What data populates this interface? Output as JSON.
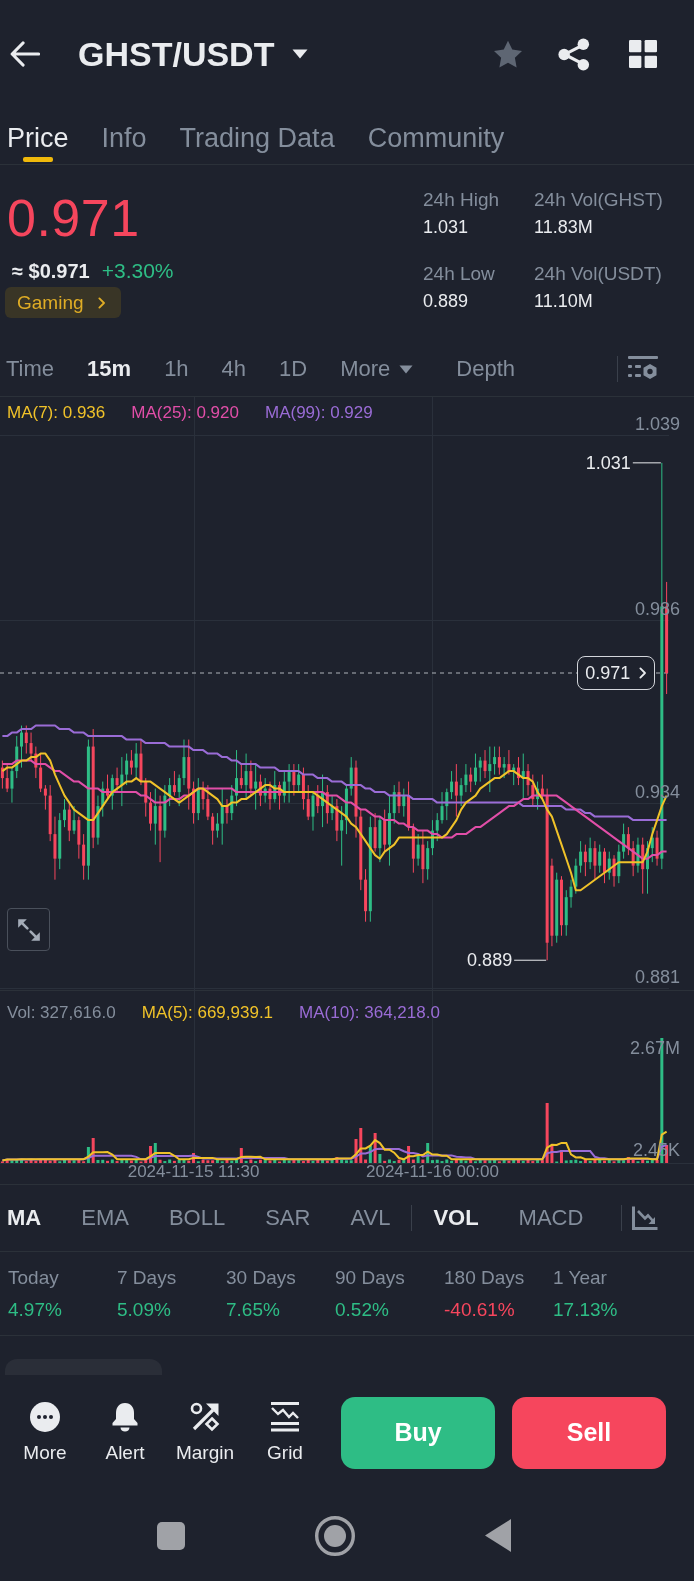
{
  "header": {
    "title": "GHST/USDT",
    "favorited": false
  },
  "tabs": [
    {
      "label": "Price",
      "selected": true
    },
    {
      "label": "Info",
      "selected": false
    },
    {
      "label": "Trading Data",
      "selected": false
    },
    {
      "label": "Community",
      "selected": false
    }
  ],
  "ticker": {
    "price": "0.971",
    "price_up": false,
    "usd_price": "≈ $0.971",
    "change": "+3.30%",
    "change_up": true,
    "tag": "Gaming"
  },
  "stats": [
    {
      "label": "24h High",
      "value": "1.031"
    },
    {
      "label": "24h Vol(GHST)",
      "value": "11.83M"
    },
    {
      "label": "24h Low",
      "value": "0.889"
    },
    {
      "label": "24h Vol(USDT)",
      "value": "11.10M"
    }
  ],
  "intervals": [
    {
      "label": "Time",
      "kind": "option",
      "selected": false
    },
    {
      "label": "15m",
      "kind": "option",
      "selected": true
    },
    {
      "label": "1h",
      "kind": "option",
      "selected": false
    },
    {
      "label": "4h",
      "kind": "option",
      "selected": false
    },
    {
      "label": "1D",
      "kind": "option",
      "selected": false
    },
    {
      "label": "More",
      "kind": "dropdown",
      "selected": false
    },
    {
      "label": "Depth",
      "kind": "view",
      "selected": false
    }
  ],
  "price_chart": {
    "chart_data": {
      "type": "candlestick",
      "grid": true,
      "ylim": [
        0.8805,
        1.0498
      ],
      "yticks": [
        {
          "value": 1.039,
          "label": "1.039"
        },
        {
          "value": 0.986,
          "label": "0.986"
        },
        {
          "value": 0.934,
          "label": "0.934"
        },
        {
          "value": 0.881,
          "label": "0.881"
        }
      ],
      "categories": [
        null,
        null,
        null,
        null,
        null,
        null,
        null,
        null,
        null,
        null,
        null,
        null,
        null,
        null,
        null,
        null,
        null,
        null,
        null,
        null,
        null,
        null,
        null,
        null,
        null,
        null,
        null,
        null,
        null,
        null,
        null,
        null,
        null,
        null,
        null,
        null,
        null,
        null,
        null,
        null,
        null,
        null,
        null,
        null,
        null,
        null,
        null,
        null,
        null,
        null,
        null,
        null,
        null,
        null,
        null,
        null,
        null,
        null,
        null,
        null,
        null,
        null,
        null,
        null,
        null,
        null,
        null,
        null,
        null,
        null,
        null,
        null,
        null,
        null,
        null,
        null,
        null,
        null,
        null,
        null,
        null,
        null,
        null,
        null,
        null,
        null,
        null,
        null,
        null,
        null,
        null,
        null,
        null,
        null,
        null,
        null,
        null,
        null,
        null,
        null,
        null,
        null,
        null,
        null,
        null,
        null,
        null,
        null,
        null,
        null,
        null,
        null,
        null,
        null,
        null,
        null,
        null,
        null,
        null,
        null,
        null,
        null,
        null,
        null,
        null,
        null,
        null,
        null,
        null,
        null,
        null,
        null,
        null,
        null,
        null,
        null,
        null,
        null,
        null,
        null
      ],
      "ohlc": [
        [
          0.944,
          0.946,
          0.938,
          0.941
        ],
        [
          0.941,
          0.945,
          0.937,
          0.938
        ],
        [
          0.938,
          0.944,
          0.934,
          0.943
        ],
        [
          0.943,
          0.953,
          0.941,
          0.95
        ],
        [
          0.95,
          0.956,
          0.944,
          0.954
        ],
        [
          0.954,
          0.956,
          0.948,
          0.951
        ],
        [
          0.951,
          0.954,
          0.946,
          0.948
        ],
        [
          0.948,
          0.95,
          0.941,
          0.944
        ],
        [
          0.944,
          0.948,
          0.937,
          0.938
        ],
        [
          0.938,
          0.939,
          0.932,
          0.936
        ],
        [
          0.936,
          0.939,
          0.923,
          0.925
        ],
        [
          0.925,
          0.93,
          0.912,
          0.918
        ],
        [
          0.918,
          0.931,
          0.915,
          0.929
        ],
        [
          0.929,
          0.935,
          0.927,
          0.932
        ],
        [
          0.932,
          0.934,
          0.923,
          0.926
        ],
        [
          0.926,
          0.933,
          0.925,
          0.929
        ],
        [
          0.929,
          0.93,
          0.918,
          0.922
        ],
        [
          0.922,
          0.925,
          0.912,
          0.916
        ],
        [
          0.916,
          0.952,
          0.912,
          0.95
        ],
        [
          0.95,
          0.955,
          0.921,
          0.924
        ],
        [
          0.924,
          0.936,
          0.922,
          0.933
        ],
        [
          0.933,
          0.94,
          0.93,
          0.938
        ],
        [
          0.938,
          0.942,
          0.935,
          0.936
        ],
        [
          0.936,
          0.942,
          0.932,
          0.941
        ],
        [
          0.941,
          0.944,
          0.937,
          0.939
        ],
        [
          0.939,
          0.947,
          0.933,
          0.942
        ],
        [
          0.942,
          0.948,
          0.939,
          0.946
        ],
        [
          0.946,
          0.949,
          0.942,
          0.944
        ],
        [
          0.944,
          0.951,
          0.941,
          0.948
        ],
        [
          0.948,
          0.952,
          0.939,
          0.94
        ],
        [
          0.94,
          0.941,
          0.93,
          0.934
        ],
        [
          0.934,
          0.937,
          0.926,
          0.928
        ],
        [
          0.928,
          0.938,
          0.922,
          0.933
        ],
        [
          0.933,
          0.936,
          0.917,
          0.926
        ],
        [
          0.926,
          0.939,
          0.924,
          0.936
        ],
        [
          0.936,
          0.941,
          0.933,
          0.939
        ],
        [
          0.939,
          0.943,
          0.936,
          0.937
        ],
        [
          0.937,
          0.942,
          0.933,
          0.941
        ],
        [
          0.941,
          0.952,
          0.939,
          0.947
        ],
        [
          0.947,
          0.952,
          0.932,
          0.938
        ],
        [
          0.938,
          0.94,
          0.928,
          0.931
        ],
        [
          0.931,
          0.941,
          0.929,
          0.938
        ],
        [
          0.938,
          0.94,
          0.932,
          0.935
        ],
        [
          0.935,
          0.939,
          0.929,
          0.93
        ],
        [
          0.93,
          0.931,
          0.922,
          0.926
        ],
        [
          0.926,
          0.931,
          0.924,
          0.928
        ],
        [
          0.928,
          0.938,
          0.922,
          0.933
        ],
        [
          0.933,
          0.935,
          0.928,
          0.931
        ],
        [
          0.931,
          0.939,
          0.929,
          0.936
        ],
        [
          0.936,
          0.949,
          0.933,
          0.941
        ],
        [
          0.941,
          0.945,
          0.938,
          0.939
        ],
        [
          0.939,
          0.948,
          0.935,
          0.943
        ],
        [
          0.943,
          0.946,
          0.936,
          0.938
        ],
        [
          0.938,
          0.945,
          0.932,
          0.94
        ],
        [
          0.94,
          0.942,
          0.933,
          0.936
        ],
        [
          0.936,
          0.941,
          0.934,
          0.938
        ],
        [
          0.938,
          0.94,
          0.932,
          0.935
        ],
        [
          0.935,
          0.943,
          0.934,
          0.939
        ],
        [
          0.939,
          0.94,
          0.932,
          0.936
        ],
        [
          0.936,
          0.943,
          0.934,
          0.94
        ],
        [
          0.94,
          0.945,
          0.934,
          0.943
        ],
        [
          0.943,
          0.945,
          0.936,
          0.939
        ],
        [
          0.939,
          0.945,
          0.937,
          0.942
        ],
        [
          0.942,
          0.944,
          0.932,
          0.935
        ],
        [
          0.935,
          0.939,
          0.929,
          0.93
        ],
        [
          0.93,
          0.937,
          0.926,
          0.936
        ],
        [
          0.936,
          0.939,
          0.931,
          0.933
        ],
        [
          0.933,
          0.942,
          0.927,
          0.937
        ],
        [
          0.937,
          0.939,
          0.928,
          0.931
        ],
        [
          0.931,
          0.936,
          0.929,
          0.933
        ],
        [
          0.933,
          0.935,
          0.923,
          0.926
        ],
        [
          0.926,
          0.933,
          0.916,
          0.929
        ],
        [
          0.929,
          0.939,
          0.925,
          0.938
        ],
        [
          0.938,
          0.947,
          0.936,
          0.944
        ],
        [
          0.944,
          0.946,
          0.924,
          0.93
        ],
        [
          0.93,
          0.932,
          0.909,
          0.912
        ],
        [
          0.912,
          0.915,
          0.9,
          0.903
        ],
        [
          0.903,
          0.93,
          0.9,
          0.927
        ],
        [
          0.927,
          0.931,
          0.92,
          0.921
        ],
        [
          0.921,
          0.93,
          0.917,
          0.929
        ],
        [
          0.929,
          0.932,
          0.92,
          0.922
        ],
        [
          0.922,
          0.936,
          0.916,
          0.931
        ],
        [
          0.931,
          0.939,
          0.928,
          0.937
        ],
        [
          0.937,
          0.94,
          0.931,
          0.933
        ],
        [
          0.933,
          0.938,
          0.93,
          0.936
        ],
        [
          0.936,
          0.94,
          0.926,
          0.927
        ],
        [
          0.927,
          0.928,
          0.914,
          0.918
        ],
        [
          0.918,
          0.925,
          0.916,
          0.922
        ],
        [
          0.922,
          0.926,
          0.911,
          0.915
        ],
        [
          0.915,
          0.923,
          0.912,
          0.921
        ],
        [
          0.921,
          0.929,
          0.919,
          0.926
        ],
        [
          0.926,
          0.931,
          0.923,
          0.929
        ],
        [
          0.929,
          0.937,
          0.928,
          0.933
        ],
        [
          0.933,
          0.938,
          0.929,
          0.937
        ],
        [
          0.937,
          0.943,
          0.935,
          0.94
        ],
        [
          0.94,
          0.945,
          0.93,
          0.936
        ],
        [
          0.936,
          0.941,
          0.933,
          0.939
        ],
        [
          0.939,
          0.945,
          0.937,
          0.942
        ],
        [
          0.942,
          0.944,
          0.937,
          0.94
        ],
        [
          0.94,
          0.948,
          0.939,
          0.944
        ],
        [
          0.944,
          0.947,
          0.94,
          0.946
        ],
        [
          0.946,
          0.949,
          0.941,
          0.943
        ],
        [
          0.943,
          0.95,
          0.937,
          0.945
        ],
        [
          0.945,
          0.95,
          0.942,
          0.947
        ],
        [
          0.947,
          0.95,
          0.942,
          0.944
        ],
        [
          0.944,
          0.947,
          0.941,
          0.945
        ],
        [
          0.945,
          0.949,
          0.942,
          0.943
        ],
        [
          0.943,
          0.945,
          0.939,
          0.944
        ],
        [
          0.944,
          0.947,
          0.939,
          0.941
        ],
        [
          0.941,
          0.948,
          0.935,
          0.943
        ],
        [
          0.943,
          0.945,
          0.936,
          0.939
        ],
        [
          0.939,
          0.942,
          0.933,
          0.935
        ],
        [
          0.935,
          0.94,
          0.932,
          0.938
        ],
        [
          0.938,
          0.942,
          0.935,
          0.936
        ],
        [
          0.936,
          0.938,
          0.889,
          0.894
        ],
        [
          0.916,
          0.918,
          0.893,
          0.896
        ],
        [
          0.896,
          0.914,
          0.894,
          0.912
        ],
        [
          0.912,
          0.913,
          0.896,
          0.899
        ],
        [
          0.899,
          0.909,
          0.896,
          0.907
        ],
        [
          0.907,
          0.912,
          0.904,
          0.91
        ],
        [
          0.91,
          0.918,
          0.908,
          0.916
        ],
        [
          0.916,
          0.923,
          0.914,
          0.92
        ],
        [
          0.92,
          0.922,
          0.913,
          0.917
        ],
        [
          0.917,
          0.924,
          0.915,
          0.921
        ],
        [
          0.921,
          0.923,
          0.912,
          0.916
        ],
        [
          0.916,
          0.922,
          0.914,
          0.92
        ],
        [
          0.92,
          0.921,
          0.911,
          0.914
        ],
        [
          0.914,
          0.92,
          0.912,
          0.918
        ],
        [
          0.918,
          0.919,
          0.91,
          0.913
        ],
        [
          0.913,
          0.922,
          0.911,
          0.92
        ],
        [
          0.92,
          0.928,
          0.918,
          0.925
        ],
        [
          0.925,
          0.927,
          0.919,
          0.921
        ],
        [
          0.921,
          0.923,
          0.913,
          0.916
        ],
        [
          0.916,
          0.924,
          0.914,
          0.922
        ],
        [
          0.922,
          0.924,
          0.908,
          0.915
        ],
        [
          0.915,
          0.923,
          0.908,
          0.921
        ],
        [
          0.921,
          0.927,
          0.917,
          0.924
        ],
        [
          0.924,
          0.926,
          0.916,
          0.918
        ],
        [
          0.918,
          1.031,
          0.915,
          0.99
        ],
        [
          0.99,
          0.997,
          0.965,
          0.971
        ]
      ],
      "series": [
        {
          "name": "MA(7): 0.936",
          "type": "line",
          "color": "#f0c229",
          "values": [
            0.943,
            0.944,
            0.944,
            0.945,
            0.946,
            0.946,
            0.947,
            0.947,
            0.948,
            0.948,
            0.946,
            0.942,
            0.939,
            0.936,
            0.934,
            0.932,
            0.931,
            0.93,
            0.929,
            0.929,
            0.931,
            0.933,
            0.935,
            0.937,
            0.938,
            0.939,
            0.94,
            0.94,
            0.941,
            0.94,
            0.94,
            0.94,
            0.939,
            0.938,
            0.937,
            0.936,
            0.935,
            0.934,
            0.935,
            0.936,
            0.937,
            0.938,
            0.938,
            0.937,
            0.936,
            0.935,
            0.933,
            0.933,
            0.934,
            0.934,
            0.935,
            0.935,
            0.936,
            0.937,
            0.938,
            0.939,
            0.939,
            0.938,
            0.938,
            0.937,
            0.937,
            0.937,
            0.937,
            0.937,
            0.937,
            0.937,
            0.936,
            0.935,
            0.934,
            0.933,
            0.932,
            0.931,
            0.93,
            0.928,
            0.927,
            0.925,
            0.923,
            0.921,
            0.919,
            0.918,
            0.92,
            0.921,
            0.922,
            0.924,
            0.924,
            0.924,
            0.924,
            0.924,
            0.924,
            0.924,
            0.924,
            0.924,
            0.924,
            0.925,
            0.927,
            0.929,
            0.932,
            0.934,
            0.935,
            0.936,
            0.938,
            0.939,
            0.94,
            0.941,
            0.941,
            0.942,
            0.943,
            0.943,
            0.942,
            0.941,
            0.941,
            0.94,
            0.937,
            0.935,
            0.932,
            0.93,
            0.926,
            0.922,
            0.918,
            0.914,
            0.909,
            0.909,
            0.91,
            0.911,
            0.912,
            0.913,
            0.914,
            0.915,
            0.916,
            0.917,
            0.917,
            0.917,
            0.917,
            0.917,
            0.917,
            0.92,
            0.925,
            0.929,
            0.933,
            0.936
          ]
        },
        {
          "name": "MA(25): 0.920",
          "type": "line",
          "color": "#e14ea8",
          "values": [
            0.945,
            0.945,
            0.945,
            0.946,
            0.946,
            0.946,
            0.946,
            0.945,
            0.945,
            0.945,
            0.944,
            0.943,
            0.943,
            0.942,
            0.941,
            0.94,
            0.94,
            0.939,
            0.938,
            0.938,
            0.938,
            0.937,
            0.937,
            0.937,
            0.937,
            0.937,
            0.937,
            0.937,
            0.937,
            0.936,
            0.936,
            0.935,
            0.934,
            0.934,
            0.934,
            0.935,
            0.935,
            0.935,
            0.936,
            0.936,
            0.937,
            0.938,
            0.938,
            0.938,
            0.938,
            0.938,
            0.938,
            0.938,
            0.938,
            0.937,
            0.937,
            0.937,
            0.937,
            0.937,
            0.937,
            0.937,
            0.937,
            0.937,
            0.937,
            0.937,
            0.937,
            0.937,
            0.937,
            0.937,
            0.937,
            0.937,
            0.937,
            0.937,
            0.936,
            0.936,
            0.936,
            0.935,
            0.934,
            0.934,
            0.933,
            0.932,
            0.932,
            0.931,
            0.93,
            0.93,
            0.929,
            0.929,
            0.929,
            0.928,
            0.928,
            0.927,
            0.927,
            0.926,
            0.926,
            0.926,
            0.925,
            0.925,
            0.924,
            0.924,
            0.924,
            0.925,
            0.925,
            0.925,
            0.926,
            0.927,
            0.927,
            0.928,
            0.929,
            0.93,
            0.931,
            0.932,
            0.933,
            0.933,
            0.934,
            0.935,
            0.935,
            0.936,
            0.936,
            0.936,
            0.936,
            0.936,
            0.936,
            0.935,
            0.934,
            0.933,
            0.932,
            0.931,
            0.93,
            0.929,
            0.928,
            0.927,
            0.926,
            0.925,
            0.924,
            0.923,
            0.922,
            0.921,
            0.92,
            0.919,
            0.918,
            0.918,
            0.919,
            0.919,
            0.92,
            0.92
          ]
        },
        {
          "name": "MA(99): 0.929",
          "type": "line",
          "color": "#9a6cd6",
          "values": [
            0.953,
            0.953,
            0.954,
            0.954,
            0.955,
            0.955,
            0.955,
            0.956,
            0.956,
            0.956,
            0.956,
            0.956,
            0.955,
            0.955,
            0.955,
            0.954,
            0.954,
            0.954,
            0.953,
            0.953,
            0.953,
            0.953,
            0.953,
            0.953,
            0.953,
            0.953,
            0.952,
            0.952,
            0.952,
            0.952,
            0.951,
            0.951,
            0.951,
            0.951,
            0.951,
            0.95,
            0.95,
            0.95,
            0.95,
            0.95,
            0.949,
            0.949,
            0.949,
            0.948,
            0.948,
            0.948,
            0.947,
            0.947,
            0.946,
            0.946,
            0.945,
            0.945,
            0.945,
            0.945,
            0.944,
            0.944,
            0.944,
            0.944,
            0.943,
            0.943,
            0.943,
            0.943,
            0.943,
            0.942,
            0.942,
            0.942,
            0.941,
            0.941,
            0.941,
            0.94,
            0.94,
            0.94,
            0.939,
            0.939,
            0.939,
            0.939,
            0.938,
            0.938,
            0.937,
            0.937,
            0.937,
            0.936,
            0.936,
            0.936,
            0.936,
            0.936,
            0.935,
            0.935,
            0.935,
            0.935,
            0.935,
            0.934,
            0.934,
            0.934,
            0.934,
            0.934,
            0.934,
            0.934,
            0.934,
            0.934,
            0.934,
            0.934,
            0.934,
            0.934,
            0.934,
            0.934,
            0.934,
            0.934,
            0.934,
            0.933,
            0.933,
            0.933,
            0.933,
            0.933,
            0.933,
            0.933,
            0.933,
            0.933,
            0.932,
            0.932,
            0.932,
            0.932,
            0.931,
            0.931,
            0.93,
            0.93,
            0.93,
            0.93,
            0.93,
            0.93,
            0.93,
            0.93,
            0.929,
            0.929,
            0.929,
            0.929,
            0.929,
            0.929,
            0.929,
            0.929
          ]
        }
      ],
      "ref_lines": [
        {
          "axis": "y",
          "value": 0.971,
          "label": "0.971"
        }
      ]
    },
    "high_label": "1.031",
    "low_label": "0.889"
  },
  "volume_chart": {
    "legend": [
      {
        "label": "Vol: 327,616.0",
        "color": "#848e9c"
      },
      {
        "label": "MA(5): 669,939.1",
        "color": "#f0c229"
      },
      {
        "label": "MA(10): 364,218.0",
        "color": "#9a6cd6"
      }
    ],
    "axis_labels": [
      "2.67M",
      "2.45K"
    ],
    "time_labels": [
      "2024-11-15 11:30",
      "2024-11-16 00:00"
    ]
  },
  "indicators": {
    "main": [
      {
        "label": "MA",
        "selected": true
      },
      {
        "label": "EMA",
        "selected": false
      },
      {
        "label": "BOLL",
        "selected": false
      },
      {
        "label": "SAR",
        "selected": false
      },
      {
        "label": "AVL",
        "selected": false
      }
    ],
    "sub": [
      {
        "label": "VOL",
        "selected": true
      },
      {
        "label": "MACD",
        "selected": false
      }
    ]
  },
  "performance": [
    {
      "period": "Today",
      "change": "4.97%",
      "up": true
    },
    {
      "period": "7 Days",
      "change": "5.09%",
      "up": true
    },
    {
      "period": "30 Days",
      "change": "7.65%",
      "up": true
    },
    {
      "period": "90 Days",
      "change": "0.52%",
      "up": true
    },
    {
      "period": "180 Days",
      "change": "-40.61%",
      "up": false
    },
    {
      "period": "1 Year",
      "change": "17.13%",
      "up": true
    }
  ],
  "actions": [
    {
      "label": "More"
    },
    {
      "label": "Alert"
    },
    {
      "label": "Margin"
    },
    {
      "label": "Grid"
    }
  ],
  "trade_buttons": [
    {
      "label": "Buy",
      "kind": "buy"
    },
    {
      "label": "Sell",
      "kind": "sell"
    }
  ]
}
